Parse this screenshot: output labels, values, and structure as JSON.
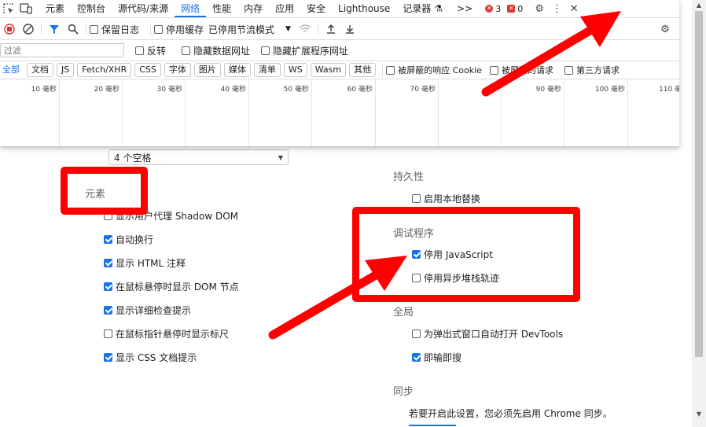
{
  "devtools": {
    "tabs": [
      "元素",
      "控制台",
      "源代码/来源",
      "网络",
      "性能",
      "内存",
      "应用",
      "安全",
      "Lighthouse",
      "记录器"
    ],
    "active_tab": "网络",
    "recorder_icon": "flask-icon",
    "more_tabs": ">>",
    "errors_count": "3",
    "issues_count": "0",
    "toolbar": {
      "preserve_log": "保留日志",
      "disable_cache": "停用缓存",
      "throttle": "已停用节流模式"
    },
    "filter": {
      "placeholder": "过滤",
      "invert": "反转",
      "hide_data_urls": "隐藏数据网址",
      "hide_extension_urls": "隐藏扩展程序网址"
    },
    "type_filters": [
      "全部",
      "文档",
      "JS",
      "Fetch/XHR",
      "CSS",
      "字体",
      "图片",
      "媒体",
      "清单",
      "WS",
      "Wasm",
      "其他"
    ],
    "blocked_cookies": "被屏蔽的响应 Cookie",
    "blocked_requests": "被屏蔽的请求",
    "third_party": "第三方请求",
    "timeline_ticks": [
      "10 毫秒",
      "20 毫秒",
      "30 毫秒",
      "40 毫秒",
      "50 毫秒",
      "60 毫秒",
      "70 毫秒",
      "80",
      "90 毫秒",
      "100 毫秒",
      "110 毫"
    ]
  },
  "settings": {
    "indent_select": "4 个空格",
    "elements": {
      "title": "元素",
      "items": [
        {
          "label": "显示用户代理 Shadow DOM",
          "checked": false
        },
        {
          "label": "自动换行",
          "checked": true
        },
        {
          "label": "显示 HTML 注释",
          "checked": true
        },
        {
          "label": "在鼠标悬停时显示 DOM 节点",
          "checked": true
        },
        {
          "label": "显示详细检查提示",
          "checked": true
        },
        {
          "label": "在鼠标指针悬停时显示标尺",
          "checked": false
        },
        {
          "label": "显示 CSS 文档提示",
          "checked": true
        }
      ]
    },
    "persistence": {
      "title": "持久性",
      "items": [
        {
          "label": "启用本地替换",
          "checked": false
        }
      ]
    },
    "debugger": {
      "title": "调试程序",
      "items": [
        {
          "label": "停用 JavaScript",
          "checked": true
        },
        {
          "label": "停用异步堆栈轨迹",
          "checked": false
        }
      ]
    },
    "global": {
      "title": "全局",
      "items": [
        {
          "label": "为弹出式窗口自动打开 DevTools",
          "checked": false
        },
        {
          "label": "即输即搜",
          "checked": true
        }
      ]
    },
    "sync": {
      "title": "同步",
      "note": "若要开启此设置，您必须先启用 Chrome 同步。"
    }
  },
  "colors": {
    "accent": "#1a73e8",
    "annotation_red": "#ff0000"
  }
}
